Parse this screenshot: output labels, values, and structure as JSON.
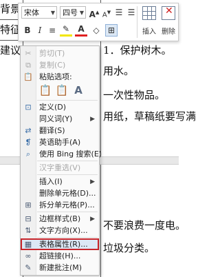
{
  "document": {
    "lines": [
      "背景",
      "特征",
      "建议",
      "1．保护树木。",
      "用水。",
      "一次性物品。",
      "用纸，草稿纸要写满",
      "不要浪费一度电。",
      "垃圾分类。"
    ]
  },
  "toolbar": {
    "font_name": "宋体",
    "font_size": "四号",
    "grow_font": "A",
    "shrink_font": "A",
    "bullets": "☰",
    "numbering": "☰",
    "bold": "B",
    "italic": "I",
    "center": "≡",
    "highlight": "✎",
    "font_color": "A",
    "shading": "◇",
    "borders": "⊞",
    "insert_label": "插入",
    "delete_label": "删除"
  },
  "menu": {
    "items": [
      {
        "label": "剪切(T)",
        "icon": "scissors-icon",
        "disabled": true
      },
      {
        "label": "复制(C)",
        "icon": "copy-icon",
        "disabled": true
      },
      {
        "label": "粘贴选项:",
        "icon": "paste-icon",
        "disabled": false
      },
      {
        "label": "定义(D)",
        "icon": "definition-icon",
        "disabled": false
      },
      {
        "label": "同义词(Y)",
        "icon": "synonyms-icon",
        "disabled": false,
        "submenu": true
      },
      {
        "label": "翻译(S)",
        "icon": "translate-icon",
        "disabled": false
      },
      {
        "label": "英语助手(A)",
        "icon": "english-assistant-icon",
        "disabled": false
      },
      {
        "label": "使用 Bing 搜索(E)",
        "icon": "bing-search-icon",
        "disabled": false
      },
      {
        "label": "汉字重选(V)",
        "icon": "",
        "disabled": true
      },
      {
        "label": "插入(I)",
        "icon": "",
        "disabled": false,
        "submenu": true
      },
      {
        "label": "删除单元格(D)...",
        "icon": "",
        "disabled": false
      },
      {
        "label": "拆分单元格(P)...",
        "icon": "split-cells-icon",
        "disabled": false
      },
      {
        "label": "边框样式(B)",
        "icon": "border-style-icon",
        "disabled": false,
        "submenu": true
      },
      {
        "label": "文字方向(X)...",
        "icon": "text-direction-icon",
        "disabled": false
      },
      {
        "label": "表格属性(R)...",
        "icon": "table-properties-icon",
        "disabled": false,
        "selected": true
      },
      {
        "label": "超链接(H)...",
        "icon": "hyperlink-icon",
        "disabled": false
      },
      {
        "label": "新建批注(M)",
        "icon": "new-comment-icon",
        "disabled": false
      }
    ]
  }
}
